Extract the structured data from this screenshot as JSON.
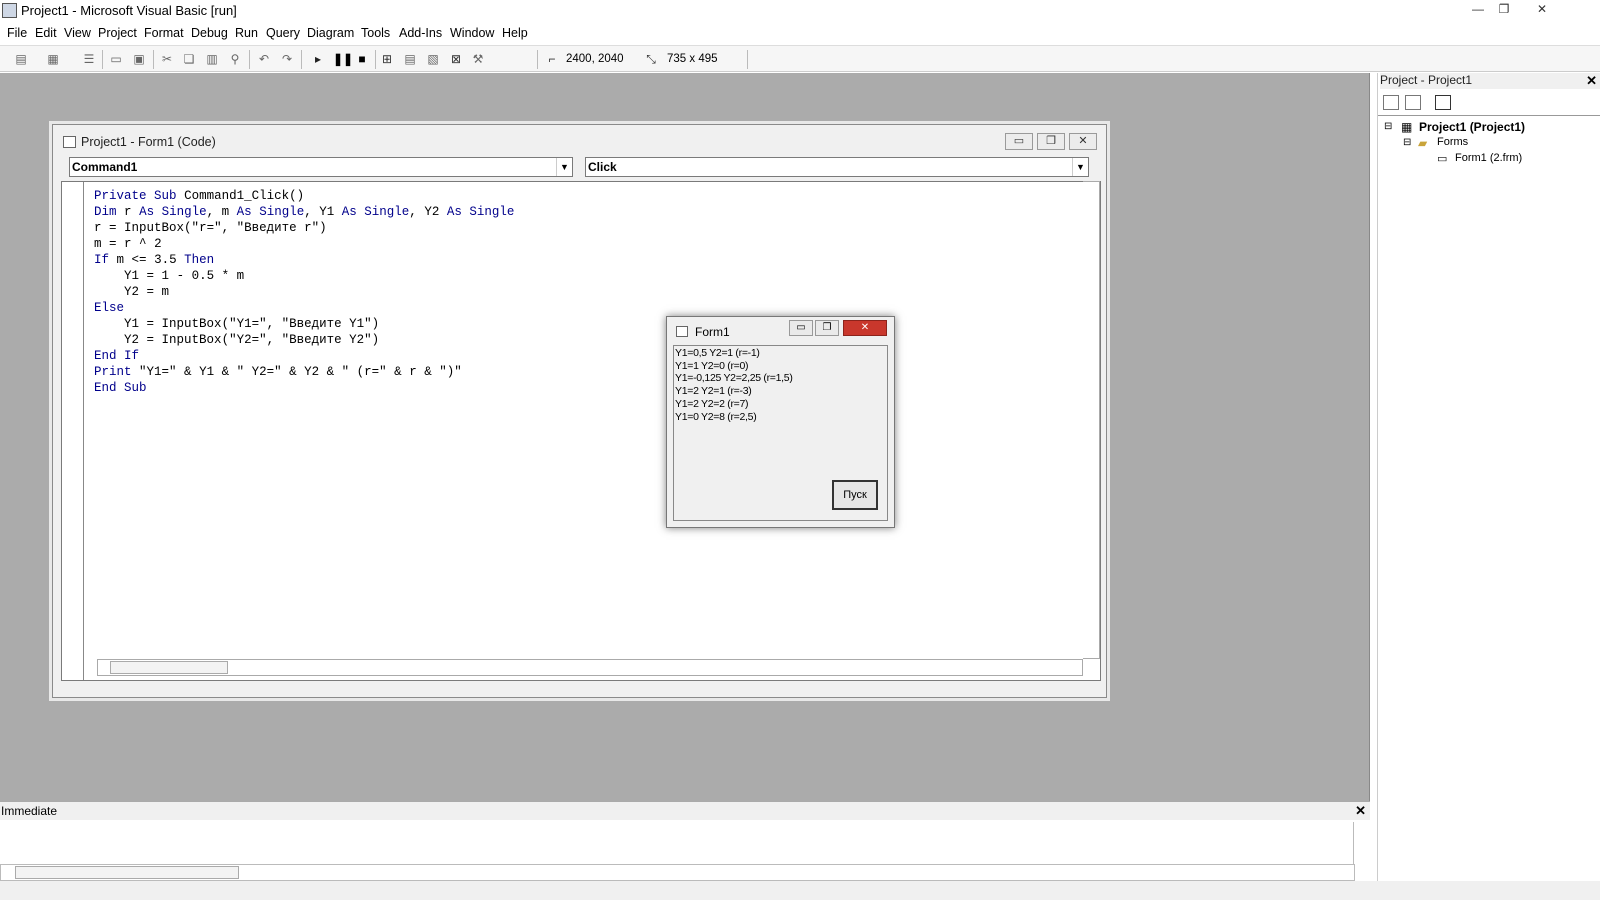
{
  "window": {
    "title": "Project1 - Microsoft Visual Basic [run]",
    "min": "—",
    "restore": "❐",
    "close": "✕"
  },
  "menu": [
    "File",
    "Edit",
    "View",
    "Project",
    "Format",
    "Debug",
    "Run",
    "Query",
    "Diagram",
    "Tools",
    "Add-Ins",
    "Window",
    "Help"
  ],
  "toolbar": {
    "position": "2400, 2040",
    "size": "735 x 495"
  },
  "code_window": {
    "title": "Project1 - Form1 (Code)",
    "object_combo": "Command1",
    "proc_combo": "Click",
    "lines": [
      "Private Sub Command1_Click()",
      "Dim r As Single, m As Single, Y1 As Single, Y2 As Single",
      "r = InputBox(\"r=\", \"Введите r\")",
      "m = r ^ 2",
      "If m <= 3.5 Then",
      "    Y1 = 1 - 0.5 * m",
      "    Y2 = m",
      "Else",
      "    Y1 = InputBox(\"Y1=\", \"Введите Y1\")",
      "    Y2 = InputBox(\"Y2=\", \"Введите Y2\")",
      "End If",
      "Print \"Y1=\" & Y1 & \" Y2=\" & Y2 & \" (r=\" & r & \")\"",
      "End Sub"
    ]
  },
  "form1": {
    "title": "Form1",
    "output": [
      "Y1=0,5 Y2=1 (r=-1)",
      "Y1=1 Y2=0 (r=0)",
      "Y1=-0,125 Y2=2,25 (r=1,5)",
      "Y1=2 Y2=1 (r=-3)",
      "Y1=2 Y2=2 (r=7)",
      "Y1=0 Y2=8 (r=2,5)"
    ],
    "button": "Пуск"
  },
  "project_panel": {
    "title": "Project - Project1",
    "root": "Project1 (Project1)",
    "folder": "Forms",
    "item": "Form1 (2.frm)"
  },
  "immediate": {
    "title": "Immediate"
  }
}
